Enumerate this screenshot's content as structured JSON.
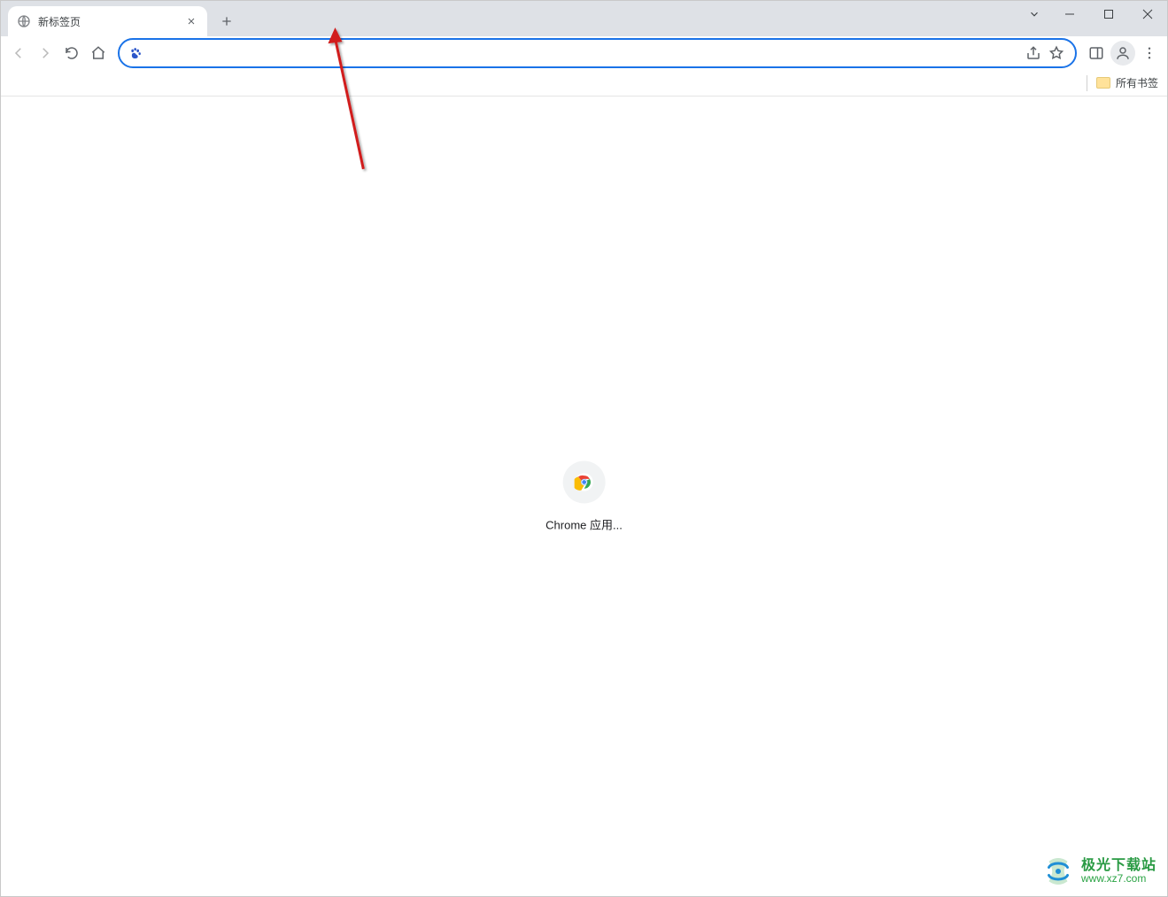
{
  "tab": {
    "title": "新标签页",
    "favicon_name": "globe-icon"
  },
  "toolbar": {
    "nav": {
      "back_enabled": false,
      "forward_enabled": false
    },
    "omnibox": {
      "value": "",
      "placeholder": ""
    }
  },
  "bookmark_bar": {
    "all_bookmarks_label": "所有书签"
  },
  "ntp": {
    "shortcut_label": "Chrome 应用..."
  },
  "watermark": {
    "title": "极光下载站",
    "url": "www.xz7.com"
  },
  "annotation": {
    "arrow_color": "#d11a1a"
  }
}
